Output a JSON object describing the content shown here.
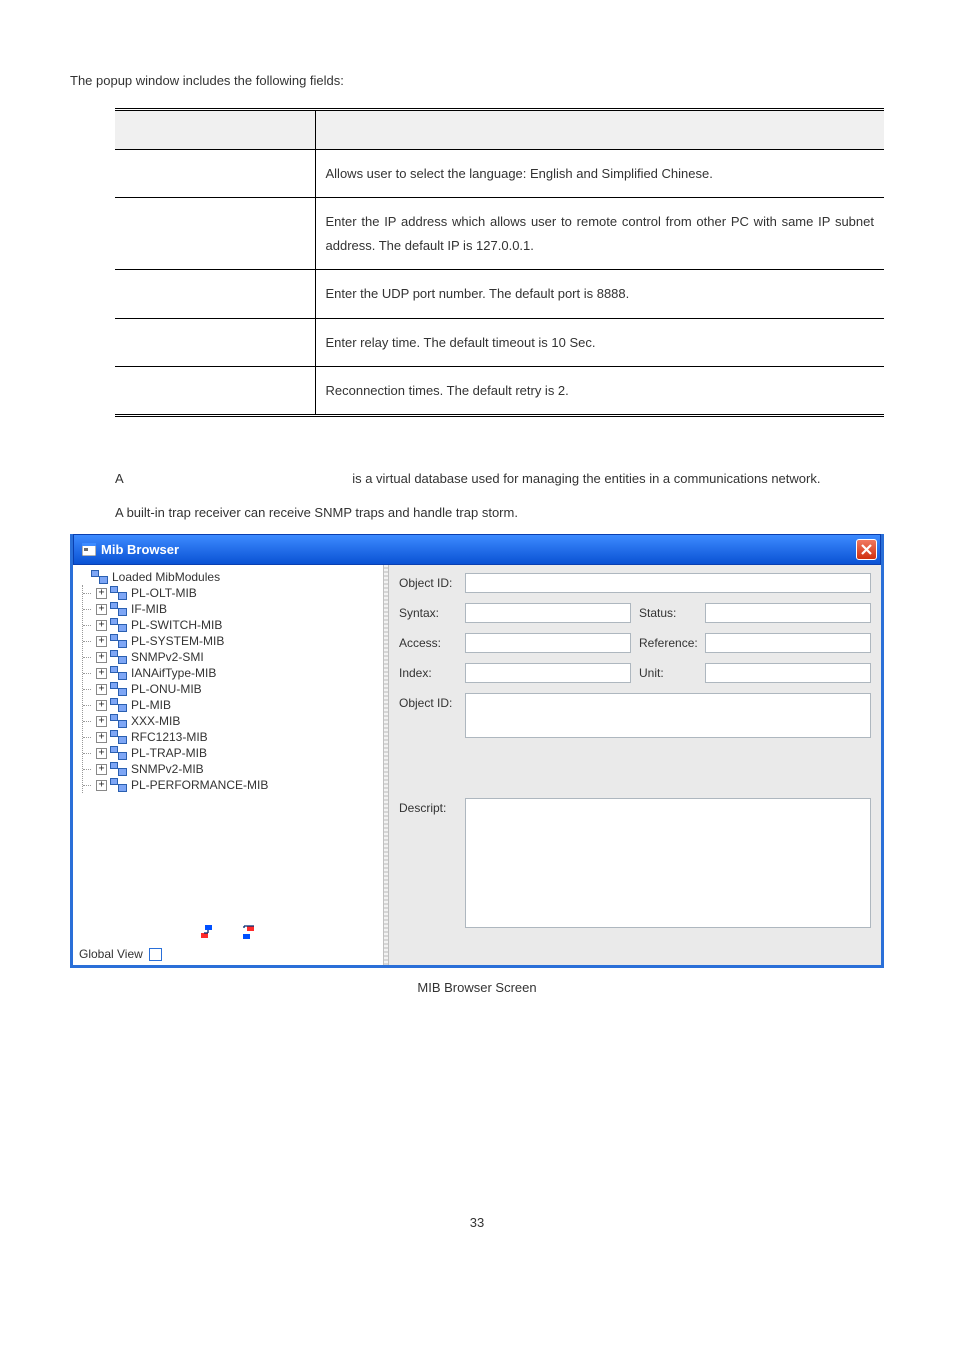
{
  "intro_text": "The popup window includes the following fields:",
  "fields_table": {
    "rows": [
      {
        "desc": "Allows user to select the language: English and Simplified Chinese."
      },
      {
        "desc": "Enter the IP address which allows user to remote control from other PC with same IP subnet address. The default IP is 127.0.0.1."
      },
      {
        "desc": "Enter the UDP port number. The default port is 8888."
      },
      {
        "desc": "Enter relay time. The default timeout is 10 Sec."
      },
      {
        "desc": "Reconnection times. The default retry is 2."
      }
    ]
  },
  "para1_prefix": "A ",
  "para1_suffix": " is a virtual database used for managing the entities in a communications network.",
  "para2": "A built-in trap receiver can receive SNMP traps and handle trap storm.",
  "mib_window": {
    "title": "Mib Browser",
    "tree": {
      "root": "Loaded MibModules",
      "items": [
        "PL-OLT-MIB",
        "IF-MIB",
        "PL-SWITCH-MIB",
        "PL-SYSTEM-MIB",
        "SNMPv2-SMI",
        "IANAifType-MIB",
        "PL-ONU-MIB",
        "PL-MIB",
        "XXX-MIB",
        "RFC1213-MIB",
        "PL-TRAP-MIB",
        "SNMPv2-MIB",
        "PL-PERFORMANCE-MIB"
      ]
    },
    "global_view_label": "Global View",
    "detail_labels": {
      "object_id": "Object ID:",
      "syntax": "Syntax:",
      "status": "Status:",
      "access": "Access:",
      "reference": "Reference:",
      "index": "Index:",
      "unit": "Unit:",
      "object_id2": "Object ID:",
      "descript": "Descript:"
    }
  },
  "caption": "MIB Browser Screen",
  "page_number": "33"
}
